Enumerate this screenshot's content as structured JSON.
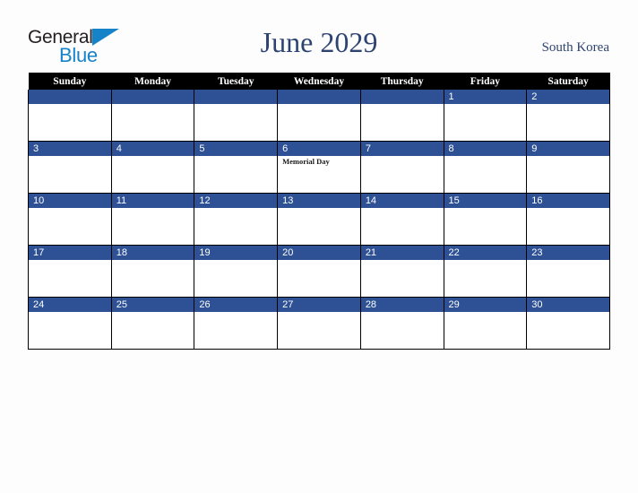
{
  "brand": {
    "name_part1": "General",
    "name_part2": "Blue",
    "triangle_icon": "triangle-icon",
    "color_dark": "#231f20",
    "color_blue": "#1683c8"
  },
  "header": {
    "title": "June 2029",
    "country": "South Korea",
    "title_color": "#2e4470"
  },
  "calendar": {
    "month": "June",
    "year": "2029",
    "weekday_headers": [
      "Sunday",
      "Monday",
      "Tuesday",
      "Wednesday",
      "Thursday",
      "Friday",
      "Saturday"
    ],
    "header_bg": "#000000",
    "daynum_bg": "#2e5195",
    "weeks": [
      [
        {
          "day": "",
          "events": []
        },
        {
          "day": "",
          "events": []
        },
        {
          "day": "",
          "events": []
        },
        {
          "day": "",
          "events": []
        },
        {
          "day": "",
          "events": []
        },
        {
          "day": "1",
          "events": []
        },
        {
          "day": "2",
          "events": []
        }
      ],
      [
        {
          "day": "3",
          "events": []
        },
        {
          "day": "4",
          "events": []
        },
        {
          "day": "5",
          "events": []
        },
        {
          "day": "6",
          "events": [
            "Memorial Day"
          ]
        },
        {
          "day": "7",
          "events": []
        },
        {
          "day": "8",
          "events": []
        },
        {
          "day": "9",
          "events": []
        }
      ],
      [
        {
          "day": "10",
          "events": []
        },
        {
          "day": "11",
          "events": []
        },
        {
          "day": "12",
          "events": []
        },
        {
          "day": "13",
          "events": []
        },
        {
          "day": "14",
          "events": []
        },
        {
          "day": "15",
          "events": []
        },
        {
          "day": "16",
          "events": []
        }
      ],
      [
        {
          "day": "17",
          "events": []
        },
        {
          "day": "18",
          "events": []
        },
        {
          "day": "19",
          "events": []
        },
        {
          "day": "20",
          "events": []
        },
        {
          "day": "21",
          "events": []
        },
        {
          "day": "22",
          "events": []
        },
        {
          "day": "23",
          "events": []
        }
      ],
      [
        {
          "day": "24",
          "events": []
        },
        {
          "day": "25",
          "events": []
        },
        {
          "day": "26",
          "events": []
        },
        {
          "day": "27",
          "events": []
        },
        {
          "day": "28",
          "events": []
        },
        {
          "day": "29",
          "events": []
        },
        {
          "day": "30",
          "events": []
        }
      ]
    ]
  }
}
